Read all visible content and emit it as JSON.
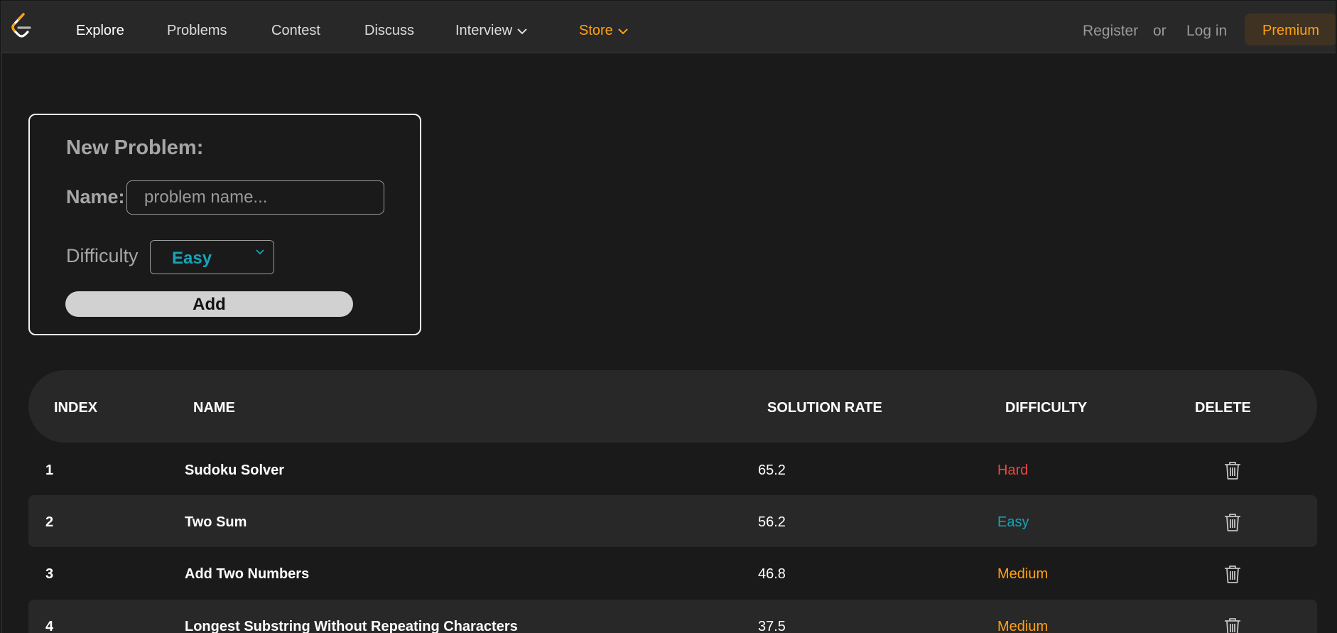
{
  "navbar": {
    "items": [
      {
        "label": "Explore"
      },
      {
        "label": "Problems"
      },
      {
        "label": "Contest"
      },
      {
        "label": "Discuss"
      },
      {
        "label": "Interview"
      },
      {
        "label": "Store"
      }
    ],
    "register_label": "Register",
    "or_label": "or",
    "login_label": "Log in",
    "premium_label": "Premium"
  },
  "form": {
    "title": "New Problem:",
    "name_label": "Name:",
    "name_placeholder": "problem name...",
    "difficulty_label": "Difficulty",
    "difficulty_selected": "Easy",
    "add_label": "Add"
  },
  "table": {
    "headers": {
      "index": "INDEX",
      "name": "NAME",
      "solution_rate": "SOLUTION RATE",
      "difficulty": "DIFFICULTY",
      "delete": "DELETE"
    },
    "rows": [
      {
        "index": "1",
        "name": "Sudoku Solver",
        "rate": "65.2",
        "difficulty": "Hard"
      },
      {
        "index": "2",
        "name": "Two Sum",
        "rate": "56.2",
        "difficulty": "Easy"
      },
      {
        "index": "3",
        "name": "Add Two Numbers",
        "rate": "46.8",
        "difficulty": "Medium"
      },
      {
        "index": "4",
        "name": "Longest Substring Without Repeating Characters",
        "rate": "37.5",
        "difficulty": "Medium"
      }
    ]
  },
  "colors": {
    "accent": "#ffa116",
    "easy": "#16a4b8",
    "medium": "#ffa116",
    "hard": "#ef4743"
  },
  "icons": {
    "logo": "leetcode-logo-icon",
    "dropdown": "chevron-down-icon",
    "delete": "trash-icon"
  }
}
